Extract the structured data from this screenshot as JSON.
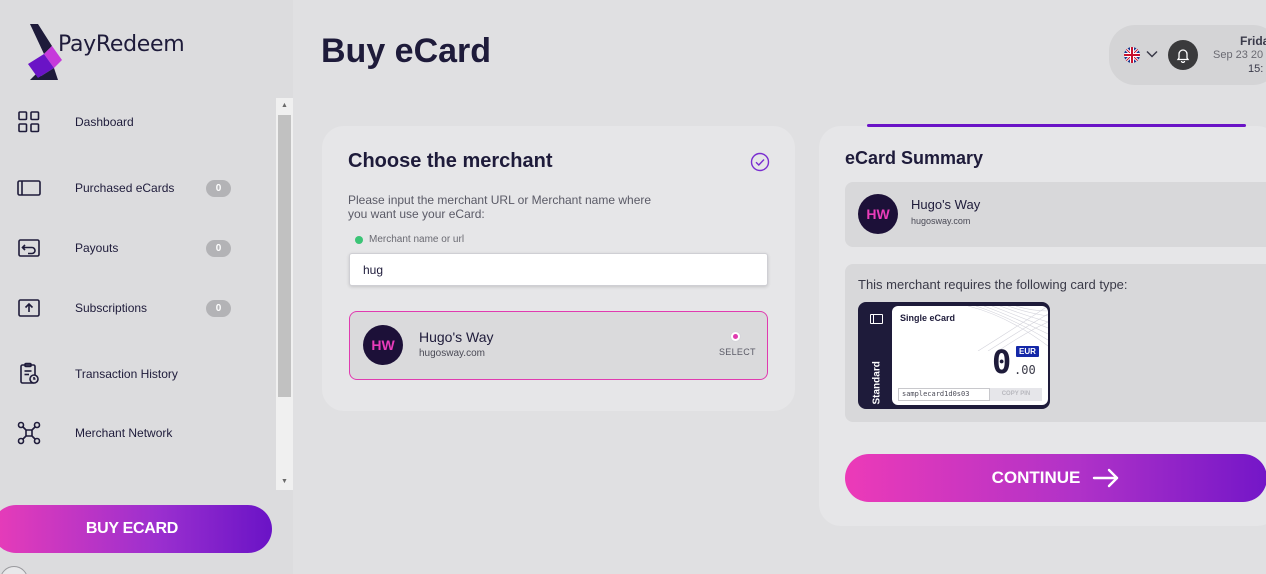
{
  "brand": {
    "name": "PayRedeem"
  },
  "sidebar": {
    "items": [
      {
        "label": "Dashboard",
        "icon": "dashboard-grid-icon"
      },
      {
        "label": "Purchased eCards",
        "icon": "card-icon",
        "badge": "0"
      },
      {
        "label": "Payouts",
        "icon": "payout-icon",
        "badge": "0"
      },
      {
        "label": "Subscriptions",
        "icon": "subscription-upload-icon",
        "badge": "0"
      },
      {
        "label": "Transaction History",
        "icon": "clipboard-history-icon"
      },
      {
        "label": "Merchant Network",
        "icon": "network-icon"
      }
    ],
    "buy_button": "BUY ECARD"
  },
  "header": {
    "title": "Buy eCard",
    "language_icon": "uk-flag-icon",
    "date_day": "Frida",
    "date_date": "Sep 23 20",
    "date_time": "15:"
  },
  "merchant": {
    "title": "Choose the merchant",
    "help_text": "Please input the merchant URL or Merchant name where you want use your eCard:",
    "field_label": "Merchant name or url",
    "input_value": "hug",
    "result": {
      "initials": "HW",
      "name": "Hugo's Way",
      "url": "hugosway.com",
      "select_label": "SELECT"
    }
  },
  "summary": {
    "title": "eCard Summary",
    "merchant_initials": "HW",
    "merchant_name": "Hugo's Way",
    "merchant_url": "hugosway.com",
    "card_type_text": "This merchant requires the following card type:",
    "card": {
      "side_label": "Standard",
      "type": "Single eCard",
      "amount": "0",
      "cents": ".00",
      "currency": "EUR",
      "code": "samplecard1d0s03",
      "copy_label": "COPY PIN"
    },
    "continue_label": "CONTINUE"
  },
  "colors": {
    "accent_pink": "#e83cb8",
    "accent_purple": "#6a13c6",
    "dark_navy": "#1e1b3a",
    "success_green": "#3bc476"
  }
}
